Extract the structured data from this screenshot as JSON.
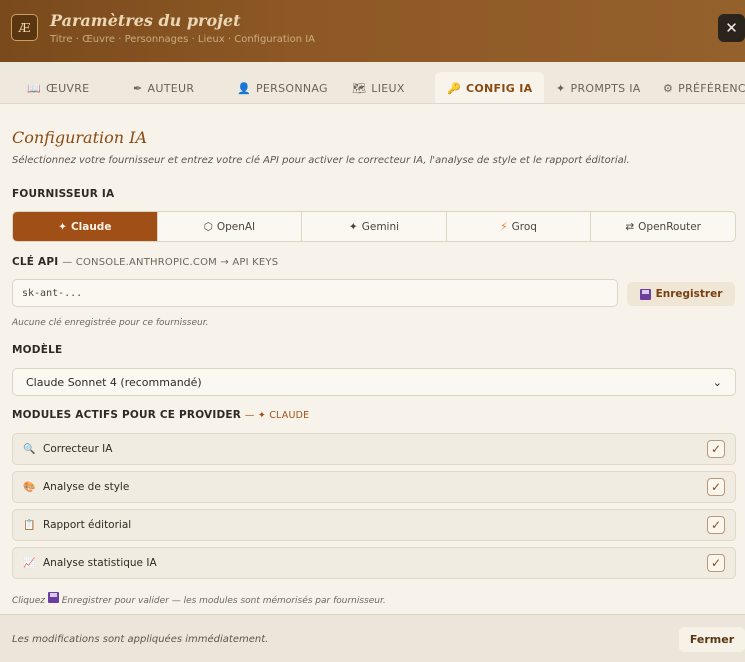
{
  "header": {
    "logo": "Æ",
    "title": "Paramètres du projet",
    "breadcrumb": "Titre · Œuvre · Personnages · Lieux · Configuration IA",
    "close": "✕"
  },
  "tabs": [
    {
      "label": "ŒUVRE",
      "icon": "📖"
    },
    {
      "label": "AUTEUR",
      "icon": "✒"
    },
    {
      "label": "PERSONNAG",
      "icon": "👤"
    },
    {
      "label": "LIEUX",
      "icon": "🗺"
    },
    {
      "label": "CONFIG IA",
      "icon": "🔑",
      "active": true
    },
    {
      "label": "PROMPTS IA",
      "icon": "✦"
    },
    {
      "label": "PRÉFÉRENC",
      "icon": "⚙"
    }
  ],
  "main": {
    "title": "Configuration IA",
    "subtitle": "Sélectionnez votre fournisseur et entrez votre clé API pour activer le correcteur IA, l'analyse de style et le rapport éditorial.",
    "provider_label": "FOURNISSEUR IA",
    "providers": [
      {
        "label": "Claude",
        "icon": "✦",
        "active": true
      },
      {
        "label": "OpenAI",
        "icon": "⬡"
      },
      {
        "label": "Gemini",
        "icon": "✦"
      },
      {
        "label": "Groq",
        "icon": "⚡"
      },
      {
        "label": "OpenRouter",
        "icon": "⇄"
      }
    ],
    "api_key_label": "CLÉ API",
    "api_key_hint": "— CONSOLE.ANTHROPIC.COM → API KEYS",
    "api_key_value": "sk-ant-...",
    "save_label": "Enregistrer",
    "no_key_note": "Aucune clé enregistrée pour ce fournisseur.",
    "model_label": "MODÈLE",
    "model_value": "Claude Sonnet 4 (recommandé)",
    "modules_label": "MODULES ACTIFS POUR CE PROVIDER",
    "modules_provider": "— ✦ CLAUDE",
    "modules": [
      {
        "label": "Correcteur IA",
        "icon": "🔍",
        "checked": true
      },
      {
        "label": "Analyse de style",
        "icon": "🎨",
        "checked": true
      },
      {
        "label": "Rapport éditorial",
        "icon": "📋",
        "checked": true
      },
      {
        "label": "Analyse statistique IA",
        "icon": "📈",
        "checked": true
      }
    ],
    "modules_note_pre": "Cliquez",
    "modules_note_post": "Enregistrer pour valider — les modules sont mémorisés par fournisseur."
  },
  "footer": {
    "note": "Les modifications sont appliquées immédiatement.",
    "close_label": "Fermer"
  }
}
